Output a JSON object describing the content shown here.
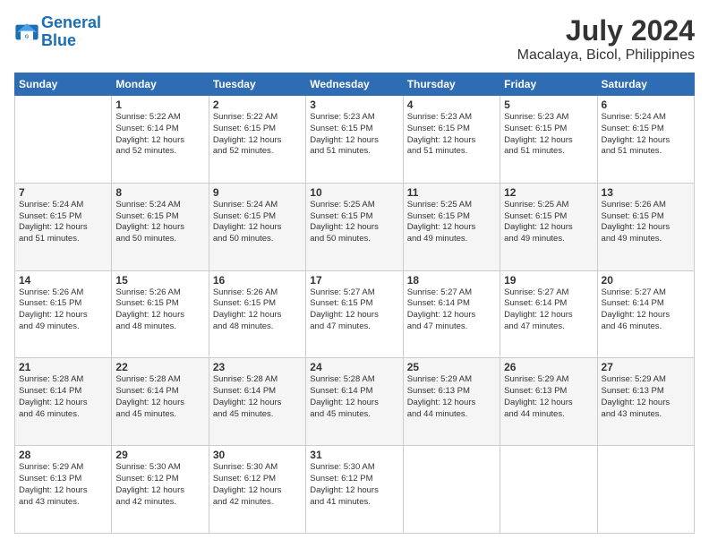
{
  "logo": {
    "line1": "General",
    "line2": "Blue"
  },
  "title": "July 2024",
  "subtitle": "Macalaya, Bicol, Philippines",
  "days_of_week": [
    "Sunday",
    "Monday",
    "Tuesday",
    "Wednesday",
    "Thursday",
    "Friday",
    "Saturday"
  ],
  "weeks": [
    [
      {
        "day": "",
        "info": ""
      },
      {
        "day": "1",
        "info": "Sunrise: 5:22 AM\nSunset: 6:14 PM\nDaylight: 12 hours\nand 52 minutes."
      },
      {
        "day": "2",
        "info": "Sunrise: 5:22 AM\nSunset: 6:15 PM\nDaylight: 12 hours\nand 52 minutes."
      },
      {
        "day": "3",
        "info": "Sunrise: 5:23 AM\nSunset: 6:15 PM\nDaylight: 12 hours\nand 51 minutes."
      },
      {
        "day": "4",
        "info": "Sunrise: 5:23 AM\nSunset: 6:15 PM\nDaylight: 12 hours\nand 51 minutes."
      },
      {
        "day": "5",
        "info": "Sunrise: 5:23 AM\nSunset: 6:15 PM\nDaylight: 12 hours\nand 51 minutes."
      },
      {
        "day": "6",
        "info": "Sunrise: 5:24 AM\nSunset: 6:15 PM\nDaylight: 12 hours\nand 51 minutes."
      }
    ],
    [
      {
        "day": "7",
        "info": "Sunrise: 5:24 AM\nSunset: 6:15 PM\nDaylight: 12 hours\nand 51 minutes."
      },
      {
        "day": "8",
        "info": "Sunrise: 5:24 AM\nSunset: 6:15 PM\nDaylight: 12 hours\nand 50 minutes."
      },
      {
        "day": "9",
        "info": "Sunrise: 5:24 AM\nSunset: 6:15 PM\nDaylight: 12 hours\nand 50 minutes."
      },
      {
        "day": "10",
        "info": "Sunrise: 5:25 AM\nSunset: 6:15 PM\nDaylight: 12 hours\nand 50 minutes."
      },
      {
        "day": "11",
        "info": "Sunrise: 5:25 AM\nSunset: 6:15 PM\nDaylight: 12 hours\nand 49 minutes."
      },
      {
        "day": "12",
        "info": "Sunrise: 5:25 AM\nSunset: 6:15 PM\nDaylight: 12 hours\nand 49 minutes."
      },
      {
        "day": "13",
        "info": "Sunrise: 5:26 AM\nSunset: 6:15 PM\nDaylight: 12 hours\nand 49 minutes."
      }
    ],
    [
      {
        "day": "14",
        "info": "Sunrise: 5:26 AM\nSunset: 6:15 PM\nDaylight: 12 hours\nand 49 minutes."
      },
      {
        "day": "15",
        "info": "Sunrise: 5:26 AM\nSunset: 6:15 PM\nDaylight: 12 hours\nand 48 minutes."
      },
      {
        "day": "16",
        "info": "Sunrise: 5:26 AM\nSunset: 6:15 PM\nDaylight: 12 hours\nand 48 minutes."
      },
      {
        "day": "17",
        "info": "Sunrise: 5:27 AM\nSunset: 6:15 PM\nDaylight: 12 hours\nand 47 minutes."
      },
      {
        "day": "18",
        "info": "Sunrise: 5:27 AM\nSunset: 6:14 PM\nDaylight: 12 hours\nand 47 minutes."
      },
      {
        "day": "19",
        "info": "Sunrise: 5:27 AM\nSunset: 6:14 PM\nDaylight: 12 hours\nand 47 minutes."
      },
      {
        "day": "20",
        "info": "Sunrise: 5:27 AM\nSunset: 6:14 PM\nDaylight: 12 hours\nand 46 minutes."
      }
    ],
    [
      {
        "day": "21",
        "info": "Sunrise: 5:28 AM\nSunset: 6:14 PM\nDaylight: 12 hours\nand 46 minutes."
      },
      {
        "day": "22",
        "info": "Sunrise: 5:28 AM\nSunset: 6:14 PM\nDaylight: 12 hours\nand 45 minutes."
      },
      {
        "day": "23",
        "info": "Sunrise: 5:28 AM\nSunset: 6:14 PM\nDaylight: 12 hours\nand 45 minutes."
      },
      {
        "day": "24",
        "info": "Sunrise: 5:28 AM\nSunset: 6:14 PM\nDaylight: 12 hours\nand 45 minutes."
      },
      {
        "day": "25",
        "info": "Sunrise: 5:29 AM\nSunset: 6:13 PM\nDaylight: 12 hours\nand 44 minutes."
      },
      {
        "day": "26",
        "info": "Sunrise: 5:29 AM\nSunset: 6:13 PM\nDaylight: 12 hours\nand 44 minutes."
      },
      {
        "day": "27",
        "info": "Sunrise: 5:29 AM\nSunset: 6:13 PM\nDaylight: 12 hours\nand 43 minutes."
      }
    ],
    [
      {
        "day": "28",
        "info": "Sunrise: 5:29 AM\nSunset: 6:13 PM\nDaylight: 12 hours\nand 43 minutes."
      },
      {
        "day": "29",
        "info": "Sunrise: 5:30 AM\nSunset: 6:12 PM\nDaylight: 12 hours\nand 42 minutes."
      },
      {
        "day": "30",
        "info": "Sunrise: 5:30 AM\nSunset: 6:12 PM\nDaylight: 12 hours\nand 42 minutes."
      },
      {
        "day": "31",
        "info": "Sunrise: 5:30 AM\nSunset: 6:12 PM\nDaylight: 12 hours\nand 41 minutes."
      },
      {
        "day": "",
        "info": ""
      },
      {
        "day": "",
        "info": ""
      },
      {
        "day": "",
        "info": ""
      }
    ]
  ]
}
